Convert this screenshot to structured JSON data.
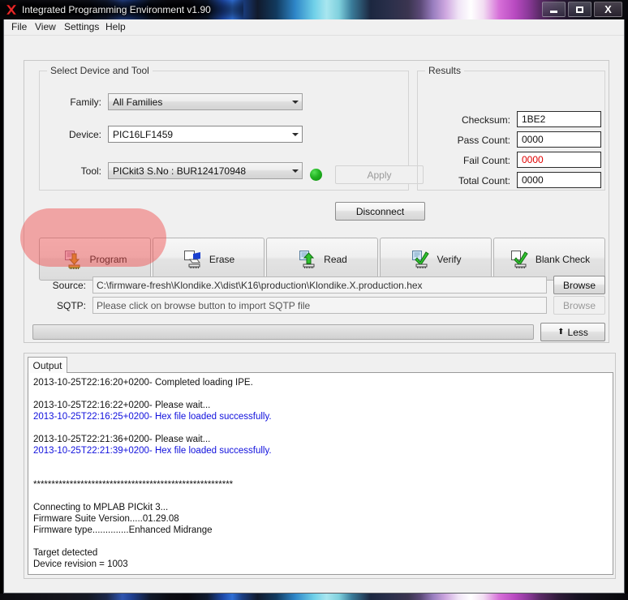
{
  "window": {
    "title": "Integrated Programming Environment v1.90",
    "app_icon": "microchip-logo-icon",
    "minimize_label": "",
    "maximize_label": "",
    "close_label": "X"
  },
  "menubar": {
    "items": [
      {
        "label": "File"
      },
      {
        "label": "View"
      },
      {
        "label": "Settings"
      },
      {
        "label": "Help"
      }
    ]
  },
  "device_group": {
    "title": "Select Device and Tool",
    "family": {
      "label": "Family:",
      "value": "All Families"
    },
    "device": {
      "label": "Device:",
      "value": "PIC16LF1459"
    },
    "tool": {
      "label": "Tool:",
      "value": "PICkit3 S.No : BUR124170948"
    },
    "status_led_color": "#22b222",
    "apply_button": "Apply",
    "disconnect_button": "Disconnect"
  },
  "results_group": {
    "title": "Results",
    "rows": [
      {
        "label": "Checksum:",
        "value": "1BE2",
        "color": "#111111"
      },
      {
        "label": "Pass Count:",
        "value": "0000",
        "color": "#111111"
      },
      {
        "label": "Fail Count:",
        "value": "0000",
        "color": "#e00000"
      },
      {
        "label": "Total Count:",
        "value": "0000",
        "color": "#111111"
      }
    ]
  },
  "actions": [
    {
      "label": "Program",
      "icon": "program-download-icon",
      "highlighted": true
    },
    {
      "label": "Erase",
      "icon": "erase-icon",
      "highlighted": false
    },
    {
      "label": "Read",
      "icon": "read-upload-icon",
      "highlighted": false
    },
    {
      "label": "Verify",
      "icon": "verify-check-icon",
      "highlighted": false
    },
    {
      "label": "Blank Check",
      "icon": "blank-check-icon",
      "highlighted": false
    }
  ],
  "source_row": {
    "label": "Source:",
    "value": "C:\\firmware-fresh\\Klondike.X\\dist\\K16\\production\\Klondike.X.production.hex",
    "browse_label": "Browse",
    "browse_enabled": true
  },
  "sqtp_row": {
    "label": "SQTP:",
    "placeholder": "Please click on browse button to import SQTP file",
    "browse_label": "Browse",
    "browse_enabled": false
  },
  "progress": {
    "value_percent": 0
  },
  "less_button": {
    "glyph": "⬆",
    "label": "Less"
  },
  "output_panel": {
    "tab_label": "Output",
    "lines": [
      {
        "text": "2013-10-25T22:16:20+0200- Completed loading IPE.",
        "color": "black"
      },
      {
        "text": "",
        "color": "black"
      },
      {
        "text": "2013-10-25T22:16:22+0200- Please wait...",
        "color": "black"
      },
      {
        "text": "2013-10-25T22:16:25+0200- Hex file loaded successfully.",
        "color": "blue"
      },
      {
        "text": "",
        "color": "black"
      },
      {
        "text": "2013-10-25T22:21:36+0200- Please wait...",
        "color": "black"
      },
      {
        "text": "2013-10-25T22:21:39+0200- Hex file loaded successfully.",
        "color": "blue"
      },
      {
        "text": "",
        "color": "black"
      },
      {
        "text": "",
        "color": "black"
      },
      {
        "text": "*******************************************************",
        "color": "black"
      },
      {
        "text": "",
        "color": "black"
      },
      {
        "text": "Connecting to MPLAB PICkit 3...",
        "color": "black"
      },
      {
        "text": "Firmware Suite Version.....01.29.08",
        "color": "black"
      },
      {
        "text": "Firmware type..............Enhanced Midrange",
        "color": "black"
      },
      {
        "text": "",
        "color": "black"
      },
      {
        "text": "Target detected",
        "color": "black"
      },
      {
        "text": "Device revision = 1003",
        "color": "black"
      }
    ]
  }
}
